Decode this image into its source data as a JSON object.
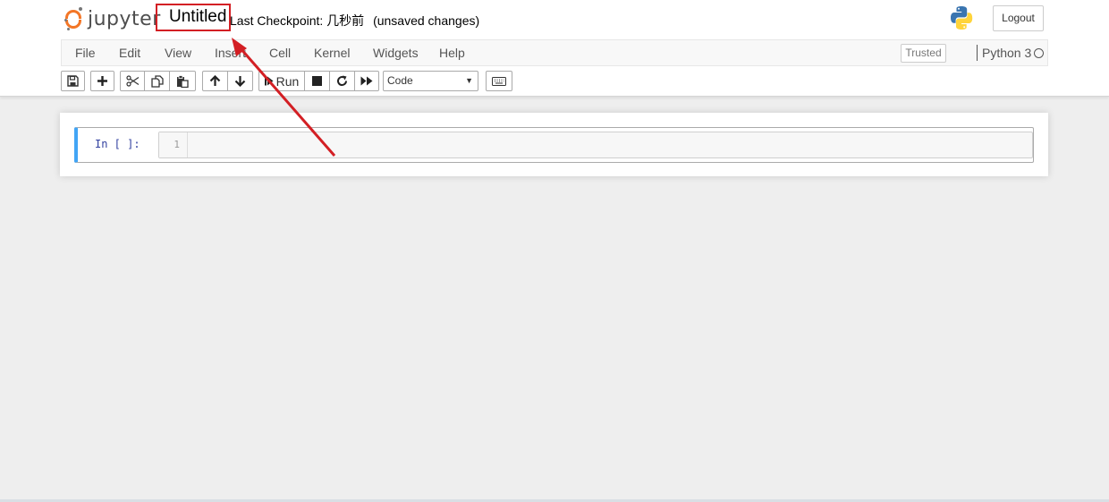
{
  "header": {
    "logo_text": "jupyter",
    "notebook_title": "Untitled",
    "checkpoint_label": "Last Checkpoint: 几秒前",
    "unsaved_label": "(unsaved changes)",
    "logout_label": "Logout",
    "python_logo_icon": "python-logo"
  },
  "menubar": {
    "items": [
      "File",
      "Edit",
      "View",
      "Insert",
      "Cell",
      "Kernel",
      "Widgets",
      "Help"
    ],
    "trusted_label": "Trusted",
    "kernel_name": "Python 3",
    "kernel_status_icon": "kernel-idle-circle"
  },
  "toolbar": {
    "buttons": [
      {
        "name": "save",
        "icon": "save-icon"
      },
      {
        "name": "insert-cell-below",
        "icon": "plus-icon"
      },
      {
        "name": "cut",
        "icon": "scissors-icon"
      },
      {
        "name": "copy",
        "icon": "copy-icon"
      },
      {
        "name": "paste",
        "icon": "paste-icon"
      },
      {
        "name": "move-up",
        "icon": "arrow-up-icon"
      },
      {
        "name": "move-down",
        "icon": "arrow-down-icon"
      },
      {
        "name": "run",
        "icon": "step-forward-icon"
      },
      {
        "name": "interrupt",
        "icon": "stop-icon"
      },
      {
        "name": "restart",
        "icon": "restart-icon"
      },
      {
        "name": "restart-run-all",
        "icon": "fast-forward-icon"
      },
      {
        "name": "command-palette",
        "icon": "keyboard-icon"
      }
    ],
    "run_label": "Run",
    "cell_type_value": "Code"
  },
  "cell": {
    "prompt": "In [ ]:",
    "line_number": "1",
    "code": ""
  },
  "colors": {
    "jupyter_orange": "#f37626",
    "highlight_red": "#d31f24",
    "selected_cell_border": "#42a5f5",
    "prompt_blue": "#303f9f"
  }
}
